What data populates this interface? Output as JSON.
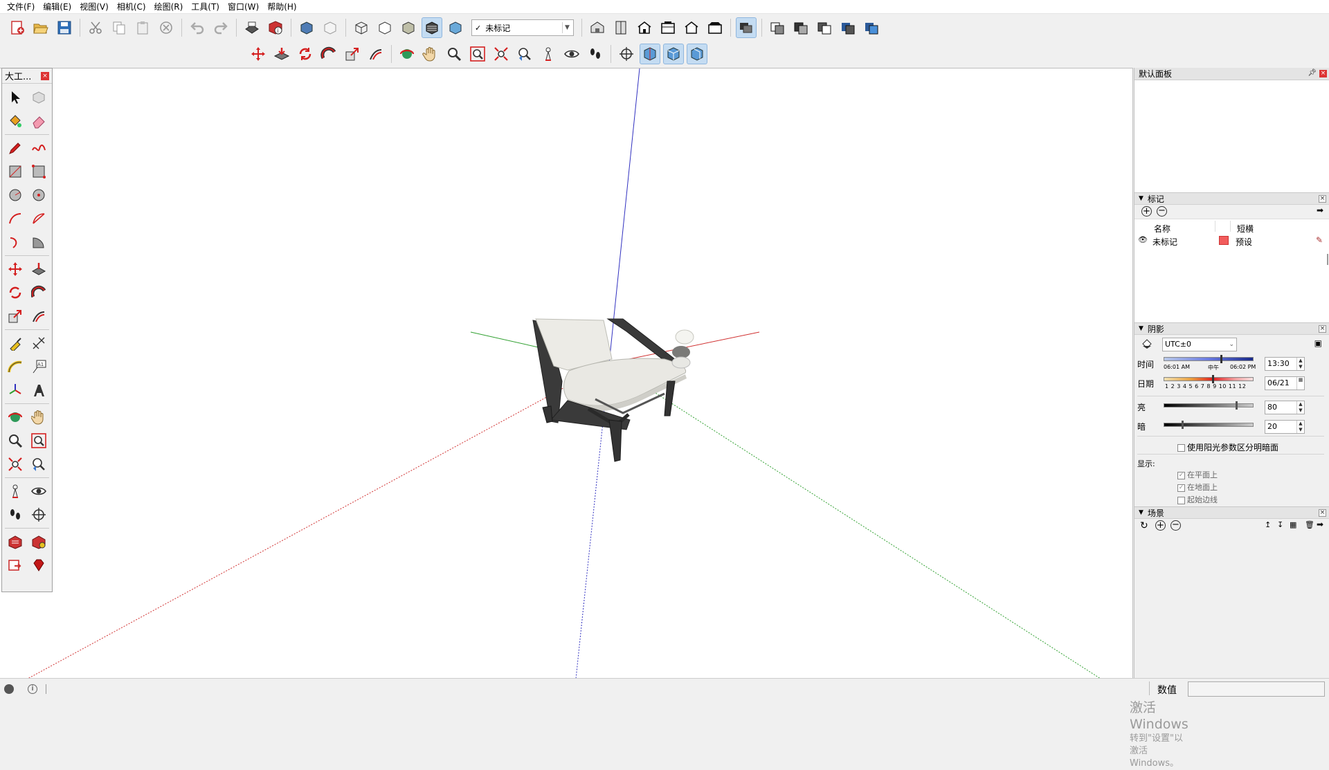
{
  "menubar": {
    "items": [
      "文件(F)",
      "编辑(E)",
      "视图(V)",
      "相机(C)",
      "绘图(R)",
      "工具(T)",
      "窗口(W)",
      "帮助(H)"
    ]
  },
  "toolbar": {
    "tag_select": {
      "value": "未标记",
      "check": "✓"
    }
  },
  "left_tray": {
    "title": "大工...",
    "close": "×"
  },
  "default_panel": {
    "title": "默认面板"
  },
  "tags": {
    "title": "标记",
    "col_name": "名称",
    "col_dash": "短横",
    "rows": [
      {
        "name": "未标记",
        "dash": "预设",
        "color": "#f25c5c"
      }
    ]
  },
  "shadows": {
    "title": "阴影",
    "timezone": "UTC±0",
    "time_label": "时间",
    "time_start": "06:01 AM",
    "time_noon": "中午",
    "time_end": "06:02 PM",
    "time_value": "13:30",
    "date_label": "日期",
    "months": "1 2 3 4 5 6 7 8 9 10 11 12",
    "date_value": "06/21",
    "light_label": "亮",
    "light_value": "80",
    "light_level": 0.8,
    "dark_label": "暗",
    "dark_value": "20",
    "dark_level": 0.2,
    "sun_option": "使用阳光参数区分明暗面",
    "display_label": "显示:",
    "on_faces": "在平面上",
    "on_ground": "在地面上",
    "from_edges": "起始边线"
  },
  "scenes": {
    "title": "场景"
  },
  "watermark": {
    "line1": "激活 Windows",
    "line2": "转到\"设置\"以激活 Windows。"
  },
  "statusbar": {
    "measure_label": "数值",
    "measure_value": ""
  },
  "colors": {
    "axis_red": "#d03030",
    "axis_green": "#30a030",
    "axis_blue": "#3030c0"
  }
}
